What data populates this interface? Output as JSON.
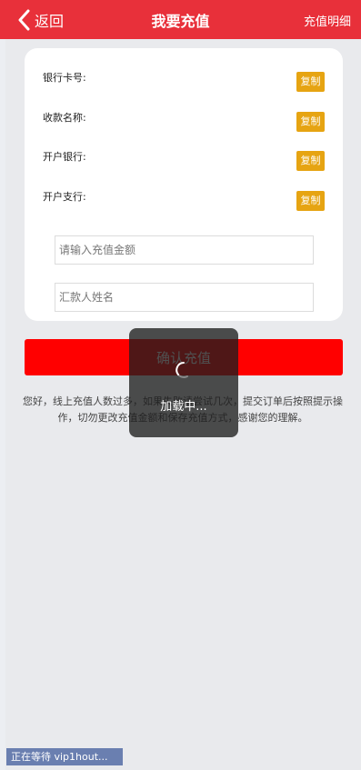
{
  "header": {
    "back_label": "返回",
    "title": "我要充值",
    "detail_link": "充值明细"
  },
  "info_rows": [
    {
      "label": "银行卡号:",
      "copy": "复制"
    },
    {
      "label": "收款名称:",
      "copy": "复制"
    },
    {
      "label": "开户银行:",
      "copy": "复制"
    },
    {
      "label": "开户支行:",
      "copy": "复制"
    }
  ],
  "form": {
    "amount_placeholder": "请输入充值金额",
    "name_placeholder": "汇款人姓名"
  },
  "confirm_label": "确认充值",
  "notice": "您好，线上充值人数过多，如果失败请尝试几次，提交订单后按照提示操作，切勿更改充值金额和保存充值方式，感谢您的理解。",
  "loading": {
    "text": "加载中..."
  },
  "status_text": "正在等待 vip1hout...",
  "colors": {
    "header": "#e8303a",
    "copy_button": "#e6a412",
    "confirm_button": "#ff0000",
    "background": "#e9eaed"
  }
}
